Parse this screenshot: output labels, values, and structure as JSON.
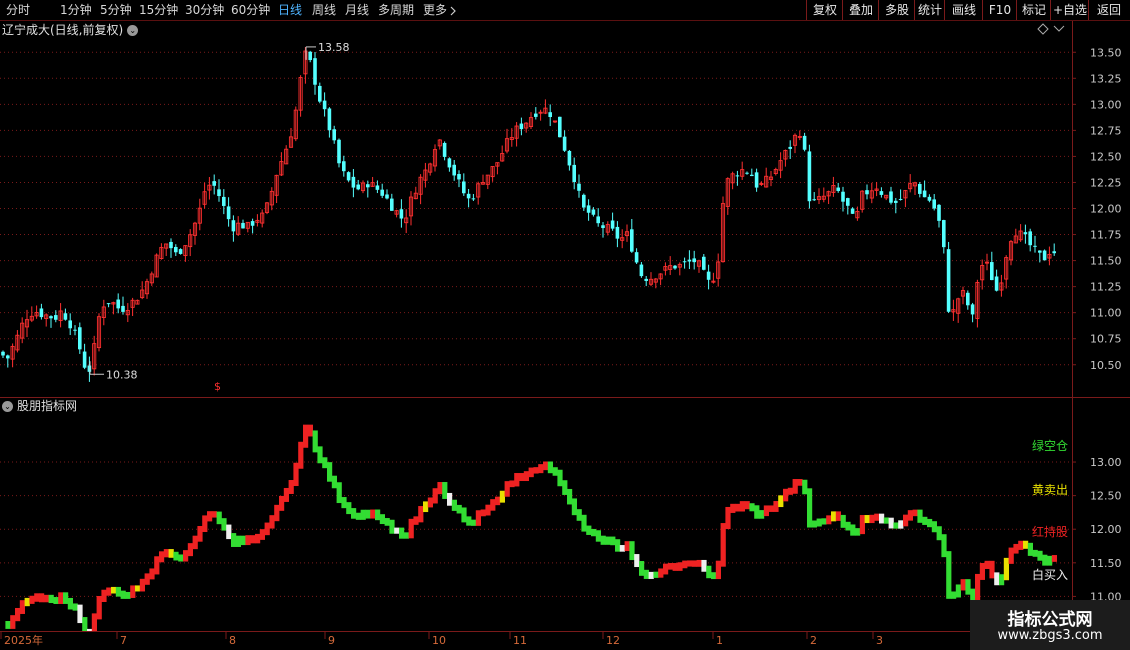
{
  "toolbar": {
    "periods": [
      "分时",
      "1分钟",
      "5分钟",
      "15分钟",
      "30分钟",
      "60分钟",
      "日线",
      "周线",
      "月线",
      "多周期",
      "更多"
    ],
    "active_period": "日线",
    "more_icon": "chevron-right-icon",
    "right_buttons": [
      "复权",
      "叠加",
      "多股",
      "统计",
      "画线",
      "F10",
      "标记",
      "+自选",
      "返回"
    ]
  },
  "main_title": "辽宁成大(日线,前复权)",
  "indicator_title": "股朋指标网",
  "price_markers": {
    "high": "13.58",
    "low": "10.38",
    "dollar": "$"
  },
  "legend": {
    "green": {
      "label": "绿空仓",
      "color": "#33dd33"
    },
    "yellow": {
      "label": "黄卖出",
      "color": "#e8e000"
    },
    "red": {
      "label": "红持股",
      "color": "#ee2222"
    },
    "white": {
      "label": "白买入",
      "color": "#eeeeee"
    }
  },
  "colors": {
    "up": "#ff3030",
    "down": "#54ffff",
    "grid": "#7a1a1a",
    "axis_text": "#c8c8c8"
  },
  "date_axis": [
    "2025年",
    "7",
    "8",
    "9",
    "10",
    "11",
    "12",
    "1",
    "2",
    "3"
  ],
  "watermark": {
    "title": "指标公式网",
    "url": "www.zbgs3.com"
  },
  "chart_data": [
    {
      "type": "candlestick",
      "title": "辽宁成大(日线,前复权)",
      "y_ticks": [
        "13.50",
        "13.25",
        "13.00",
        "12.75",
        "12.50",
        "12.25",
        "12.00",
        "11.75",
        "11.50",
        "11.25",
        "11.00",
        "10.75",
        "10.50"
      ],
      "ylim": [
        10.2,
        13.8
      ],
      "annotations": [
        {
          "label": "13.58",
          "type": "high"
        },
        {
          "label": "10.38",
          "type": "low"
        }
      ],
      "close_path": [
        [
          0,
          10.62
        ],
        [
          7,
          10.55
        ],
        [
          18,
          10.78
        ],
        [
          25,
          10.95
        ],
        [
          34,
          11.02
        ],
        [
          44,
          10.98
        ],
        [
          55,
          10.95
        ],
        [
          62,
          11.02
        ],
        [
          70,
          10.9
        ],
        [
          78,
          10.72
        ],
        [
          84,
          10.5
        ],
        [
          90,
          10.45
        ],
        [
          95,
          10.7
        ],
        [
          100,
          11.02
        ],
        [
          106,
          11.12
        ],
        [
          112,
          11.1
        ],
        [
          120,
          11.03
        ],
        [
          128,
          11.07
        ],
        [
          135,
          11.12
        ],
        [
          145,
          11.25
        ],
        [
          152,
          11.42
        ],
        [
          160,
          11.6
        ],
        [
          168,
          11.68
        ],
        [
          175,
          11.55
        ],
        [
          182,
          11.62
        ],
        [
          190,
          11.75
        ],
        [
          198,
          11.92
        ],
        [
          205,
          12.18
        ],
        [
          212,
          12.25
        ],
        [
          218,
          12.15
        ],
        [
          225,
          11.98
        ],
        [
          232,
          11.82
        ],
        [
          240,
          11.85
        ],
        [
          248,
          11.82
        ],
        [
          256,
          11.9
        ],
        [
          264,
          11.93
        ],
        [
          270,
          12.1
        ],
        [
          276,
          12.32
        ],
        [
          284,
          12.52
        ],
        [
          290,
          12.68
        ],
        [
          296,
          12.95
        ],
        [
          302,
          13.32
        ],
        [
          306,
          13.5
        ],
        [
          312,
          13.35
        ],
        [
          318,
          13.1
        ],
        [
          325,
          12.9
        ],
        [
          332,
          12.7
        ],
        [
          338,
          12.45
        ],
        [
          345,
          12.3
        ],
        [
          352,
          12.22
        ],
        [
          360,
          12.18
        ],
        [
          368,
          12.25
        ],
        [
          375,
          12.2
        ],
        [
          382,
          12.15
        ],
        [
          390,
          12.05
        ],
        [
          398,
          11.95
        ],
        [
          404,
          11.88
        ],
        [
          410,
          12.05
        ],
        [
          418,
          12.25
        ],
        [
          425,
          12.35
        ],
        [
          432,
          12.52
        ],
        [
          438,
          12.7
        ],
        [
          444,
          12.55
        ],
        [
          450,
          12.42
        ],
        [
          456,
          12.3
        ],
        [
          462,
          12.18
        ],
        [
          468,
          12.08
        ],
        [
          475,
          12.15
        ],
        [
          482,
          12.28
        ],
        [
          490,
          12.35
        ],
        [
          496,
          12.42
        ],
        [
          503,
          12.55
        ],
        [
          510,
          12.68
        ],
        [
          516,
          12.75
        ],
        [
          522,
          12.8
        ],
        [
          528,
          12.85
        ],
        [
          534,
          12.92
        ],
        [
          540,
          12.95
        ],
        [
          546,
          12.95
        ],
        [
          552,
          12.9
        ],
        [
          558,
          12.75
        ],
        [
          564,
          12.6
        ],
        [
          570,
          12.42
        ],
        [
          576,
          12.25
        ],
        [
          582,
          12.0
        ],
        [
          590,
          11.95
        ],
        [
          596,
          11.85
        ],
        [
          604,
          11.82
        ],
        [
          612,
          11.78
        ],
        [
          620,
          11.7
        ],
        [
          628,
          11.75
        ],
        [
          636,
          11.5
        ],
        [
          642,
          11.35
        ],
        [
          650,
          11.33
        ],
        [
          658,
          11.38
        ],
        [
          664,
          11.4
        ],
        [
          672,
          11.45
        ],
        [
          680,
          11.45
        ],
        [
          688,
          11.48
        ],
        [
          696,
          11.5
        ],
        [
          702,
          11.4
        ],
        [
          708,
          11.28
        ],
        [
          714,
          11.35
        ],
        [
          720,
          11.6
        ],
        [
          724,
          12.2
        ],
        [
          730,
          12.3
        ],
        [
          738,
          12.35
        ],
        [
          745,
          12.38
        ],
        [
          752,
          12.32
        ],
        [
          758,
          12.2
        ],
        [
          765,
          12.25
        ],
        [
          772,
          12.32
        ],
        [
          780,
          12.45
        ],
        [
          787,
          12.55
        ],
        [
          792,
          12.62
        ],
        [
          798,
          12.75
        ],
        [
          803,
          12.72
        ],
        [
          808,
          12.12
        ],
        [
          815,
          12.05
        ],
        [
          822,
          12.1
        ],
        [
          830,
          12.15
        ],
        [
          836,
          12.2
        ],
        [
          842,
          12.08
        ],
        [
          848,
          12.0
        ],
        [
          855,
          11.85
        ],
        [
          862,
          12.12
        ],
        [
          870,
          12.18
        ],
        [
          876,
          12.22
        ],
        [
          882,
          12.15
        ],
        [
          888,
          12.1
        ],
        [
          895,
          12.05
        ],
        [
          902,
          12.1
        ],
        [
          910,
          12.22
        ],
        [
          916,
          12.25
        ],
        [
          922,
          12.12
        ],
        [
          930,
          12.08
        ],
        [
          937,
          11.95
        ],
        [
          943,
          11.7
        ],
        [
          948,
          11.05
        ],
        [
          954,
          11.0
        ],
        [
          960,
          11.2
        ],
        [
          966,
          11.15
        ],
        [
          972,
          10.9
        ],
        [
          978,
          11.35
        ],
        [
          984,
          11.5
        ],
        [
          990,
          11.4
        ],
        [
          996,
          11.2
        ],
        [
          1002,
          11.35
        ],
        [
          1008,
          11.65
        ],
        [
          1014,
          11.8
        ],
        [
          1020,
          11.75
        ],
        [
          1026,
          11.7
        ],
        [
          1032,
          11.62
        ],
        [
          1038,
          11.55
        ],
        [
          1044,
          11.52
        ],
        [
          1050,
          11.6
        ],
        [
          1056,
          11.58
        ]
      ]
    },
    {
      "type": "step-line",
      "title": "股朋指标网",
      "y_ticks": [
        "13.00",
        "12.50",
        "12.00",
        "11.50",
        "11.00"
      ],
      "ylim": [
        10.5,
        13.7
      ],
      "series": [
        {
          "name": "绿空仓",
          "color": "#33dd33"
        },
        {
          "name": "黄卖出",
          "color": "#e8e000"
        },
        {
          "name": "红持股",
          "color": "#ee2222"
        },
        {
          "name": "白买入",
          "color": "#eeeeee"
        }
      ]
    }
  ]
}
